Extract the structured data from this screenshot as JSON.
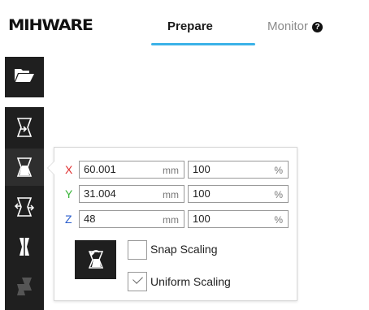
{
  "app": {
    "logo": "MIHWARE"
  },
  "tabs": [
    {
      "label": "Prepare",
      "active": true
    },
    {
      "label": "Monitor",
      "active": false
    }
  ],
  "icons": {
    "help": "question-circle-icon",
    "open": "folder-open-icon",
    "translate": "move-tool-icon",
    "scale": "scale-tool-icon",
    "rotate": "rotate-tool-icon",
    "mirror": "mirror-tool-icon",
    "per_model": "per-model-settings-icon",
    "reset": "reset-scale-icon"
  },
  "help_glyph": "?",
  "scale_panel": {
    "rows": [
      {
        "axis": "X",
        "color": "#e03030",
        "size": "60.001",
        "size_unit": "mm",
        "percent": "100",
        "percent_unit": "%"
      },
      {
        "axis": "Y",
        "color": "#3ab53a",
        "size": "31.004",
        "size_unit": "mm",
        "percent": "100",
        "percent_unit": "%"
      },
      {
        "axis": "Z",
        "color": "#2b5ecc",
        "size": "48",
        "size_unit": "mm",
        "percent": "100",
        "percent_unit": "%"
      }
    ],
    "snap_scaling": {
      "label": "Snap Scaling",
      "checked": false
    },
    "uniform_scaling": {
      "label": "Uniform Scaling",
      "checked": true
    }
  },
  "colors": {
    "accent": "#3bb2e8",
    "sidebar": "#1f1f1f"
  }
}
